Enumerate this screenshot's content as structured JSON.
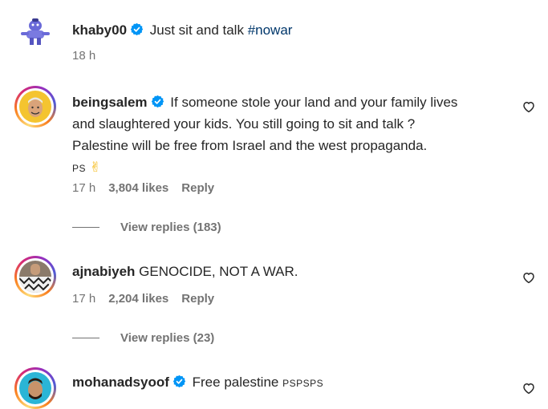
{
  "comments": [
    {
      "username": "khaby00",
      "text": "Just sit and talk",
      "hashtag": "#nowar",
      "time": "18 h"
    },
    {
      "username": "beingsalem",
      "text_line1": "If someone stole your land and your family lives",
      "text_line2": "and slaughtered your kids. You still going to sit and talk ?",
      "text_line3": "Palestine will be free from Israel and the west propaganda.",
      "ps": "PS",
      "emoji": "✌",
      "time": "17 h",
      "likes": "3,804 likes",
      "reply": "Reply",
      "view_replies": "View replies (183)"
    },
    {
      "username": "ajnabiyeh",
      "text": "GENOCIDE, NOT A WAR.",
      "time": "17 h",
      "likes": "2,204 likes",
      "reply": "Reply",
      "view_replies": "View replies (23)"
    },
    {
      "username": "mohanadsyoof",
      "text": "Free palestine",
      "ps": "PSPSPS"
    }
  ],
  "colors": {
    "text": "#262626",
    "secondary": "#737373",
    "verified": "#0095f6",
    "hashtag": "#00376b"
  },
  "icons": [
    "verified-badge-icon",
    "heart-icon"
  ]
}
